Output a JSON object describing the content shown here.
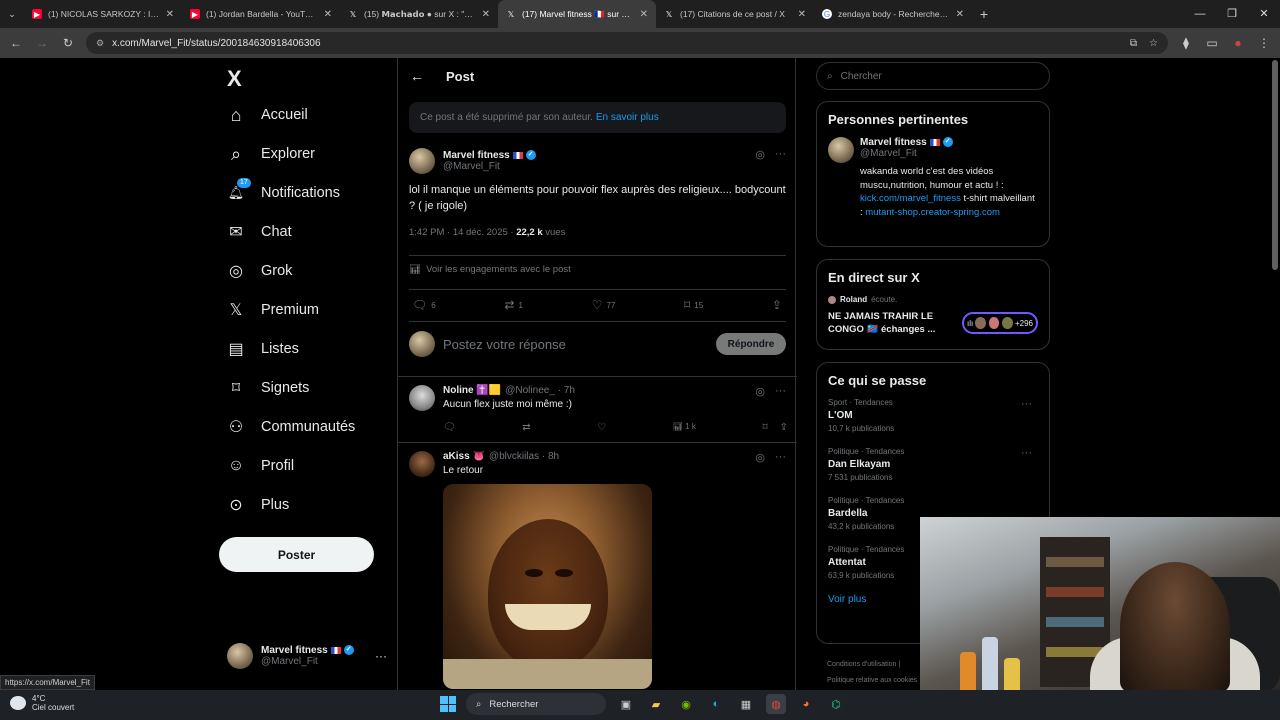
{
  "browser": {
    "tabs": [
      {
        "title": "(1) NICOLAS SARKOZY : INTERV",
        "fav_color": "#ff0033",
        "fav_glyph": "▶"
      },
      {
        "title": "(1) Jordan Bardella - YouTube",
        "fav_color": "#ff0033",
        "fav_glyph": "▶"
      },
      {
        "title": "(15) 𝗠𝗮𝗰𝗵𝗮𝗱𝗼 ● sur X : \"https:",
        "fav_color": "#000000",
        "fav_glyph": "𝕏"
      },
      {
        "title": "(17) Marvel fitness 🇫🇷 sur X : \"@",
        "fav_color": "#000000",
        "fav_glyph": "𝕏"
      },
      {
        "title": "(17) Citations de ce post / X",
        "fav_color": "#000000",
        "fav_glyph": "𝕏"
      },
      {
        "title": "zendaya body - Recherche Goo",
        "fav_color": "#4285f4",
        "fav_glyph": "G"
      }
    ],
    "url": "x.com/Marvel_Fit/status/2001846309184063​06",
    "url_text": "x.com/Marvel_Fit/status/2001846309184063‌06"
  },
  "nav": {
    "logo": "X",
    "items": [
      {
        "label": "Accueil",
        "icon": "home-icon",
        "glyph": "⌂"
      },
      {
        "label": "Explorer",
        "icon": "search-icon",
        "glyph": "⌕"
      },
      {
        "label": "Notifications",
        "icon": "bell-icon",
        "glyph": "🔔︎",
        "badge": "17"
      },
      {
        "label": "Chat",
        "icon": "mail-icon",
        "glyph": "✉"
      },
      {
        "label": "Grok",
        "icon": "grok-icon",
        "glyph": "◎"
      },
      {
        "label": "Premium",
        "icon": "x-premium-icon",
        "glyph": "𝕏"
      },
      {
        "label": "Listes",
        "icon": "list-icon",
        "glyph": "▤"
      },
      {
        "label": "Signets",
        "icon": "bookmark-icon",
        "glyph": "⌑"
      },
      {
        "label": "Communautés",
        "icon": "communities-icon",
        "glyph": "⚇"
      },
      {
        "label": "Profil",
        "icon": "profile-icon",
        "glyph": "☺"
      },
      {
        "label": "Plus",
        "icon": "more-circle-icon",
        "glyph": "⊙"
      }
    ],
    "post_button": "Poster",
    "account": {
      "name": "Marvel fitness",
      "handle": "@Marvel_Fit"
    }
  },
  "main": {
    "header": "Post",
    "deleted_notice": "Ce post a été supprimé par son auteur.",
    "deleted_link": "En savoir plus",
    "post": {
      "name": "Marvel fitness",
      "handle": "@Marvel_Fit",
      "text": "lol il manque un éléments pour pouvoir flex auprès des religieux.... bodycount ? ( je rigole)",
      "time": "1:42 PM · 14 déc. 2025 · ",
      "views": "22,2 k",
      "views_label": " vues",
      "engagements": "Voir les engagements avec le post",
      "stats": {
        "replies": "6",
        "reposts": "1",
        "likes": "77",
        "bookmarks": "15"
      }
    },
    "reply_placeholder": "Postez votre réponse",
    "reply_button": "Répondre",
    "comments": [
      {
        "name": "Noline ✝️🟨",
        "handle": "@Nolinee_ · 7h",
        "text": "Aucun flex juste moi même :)",
        "views": "1 k"
      },
      {
        "name": "aKiss 👅",
        "handle": "@blvckiilas · 8h",
        "text": "Le retour"
      }
    ]
  },
  "sidebar": {
    "search_placeholder": "Chercher",
    "people": {
      "title": "Personnes pertinentes",
      "name": "Marvel fitness",
      "handle": "@Marvel_Fit",
      "bio": "wakanda world c'est des vidéos muscu,nutrition, humour et actu ! :",
      "link1": "kick.com/marvel_fitness",
      "bio2": " t-shirt malveillant : ",
      "link2": "mutant-shop.creator-spring.com"
    },
    "live": {
      "title": "En direct sur X",
      "host": "Roland",
      "host_suffix": "écoute.",
      "space_title": "NE JAMAIS TRAHIR LE CONGO 🇨🇩 échanges ...",
      "listeners": "+296"
    },
    "trends": {
      "title": "Ce qui se passe",
      "items": [
        {
          "cat": "Sport · Tendances",
          "name": "L'OM",
          "count": "10,7 k publications"
        },
        {
          "cat": "Politique · Tendances",
          "name": "Dan Elkayam",
          "count": "7 531 publications"
        },
        {
          "cat": "Politique · Tendances",
          "name": "Bardella",
          "count": "43,2 k publications"
        },
        {
          "cat": "Politique · Tendances",
          "name": "Attentat",
          "count": "63,9 k publications"
        }
      ],
      "more": "Voir plus"
    },
    "footer1": "Conditions d'utilisation  |",
    "footer2": "Politique relative aux cookies"
  },
  "status_tooltip": "https://x.com/Marvel_Fit",
  "taskbar": {
    "temp": "4°C",
    "weather": "Ciel couvert",
    "search": "Rechercher"
  },
  "colors": {
    "accent": "#1d9bf0",
    "background": "#000000",
    "border": "#2f3336",
    "muted": "#71767b"
  }
}
